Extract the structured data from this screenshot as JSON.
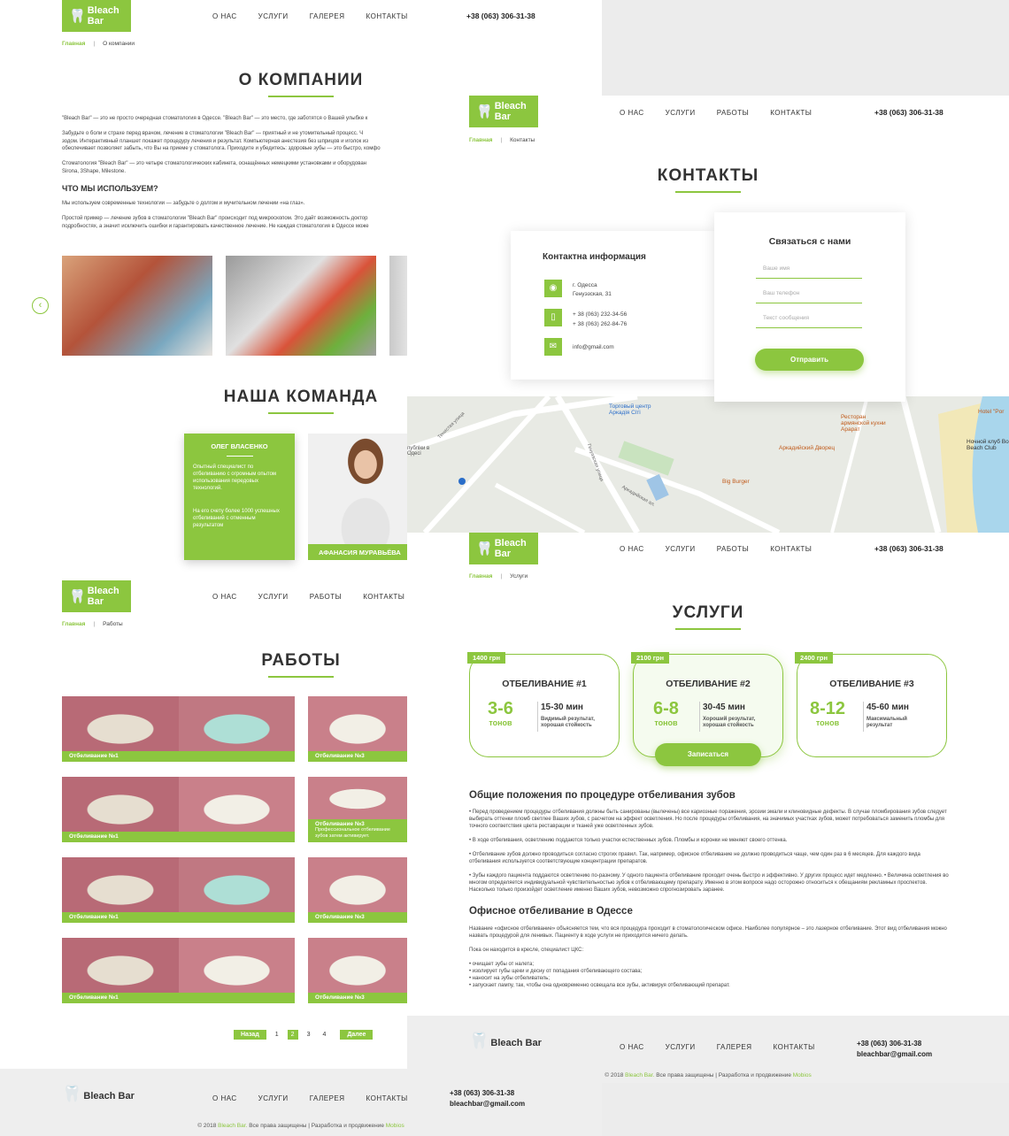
{
  "brand": {
    "name": "Bleach Bar",
    "accent": "#8cc63f"
  },
  "nav_company": [
    "О НАС",
    "УСЛУГИ",
    "ГАЛЕРЕЯ",
    "КОНТАКТЫ"
  ],
  "nav_works": [
    "О НАС",
    "УСЛУГИ",
    "РАБОТЫ",
    "КОНТАКТЫ"
  ],
  "phone": "+38 (063) 306-31-38",
  "email": "bleachbar@gmail.com",
  "company": {
    "crumb_home": "Главная",
    "crumb_current": "О компании",
    "title": "О КОМПАНИИ",
    "p1": "\"Bleach Bar\" — это не просто очередная стоматология в Одессе. \"Bleach Bar\" — это место, где заботятся о Вашей улыбке к",
    "p2a": "Забудьте о боли и страхе перед врачом, лечение в стоматологии \"Bleach Bar\" — приятный и не утомительный процесс. Ч",
    "p2b": "зодом. Интерактивный планшет покажет процедуру лечения и результат. Компьютерная анестезия без шприцов и иголок из",
    "p2c": "обеспечивает позволяет забыть, что Вы на приеме у стоматолога. Приходите и убедитесь: здоровые зубы — это быстро, комфо",
    "p3a": "Стоматология \"Bleach Bar\" — это четыре стоматологических кабинета, оснащённых немецкими установками и оборудован",
    "p3b": "Sirona, 3Shape, Milestone.",
    "subtitle": "ЧТО МЫ ИСПОЛЬЗУЕМ?",
    "p4": "Мы используем современные технологии — забудьте о долгом и мучительном лечении «на глаз».",
    "p5a": "Простой пример — лечение зубов в стоматологии \"Bleach Bar\" происходит под микроскопом. Это дайт возможность доктор",
    "p5b": "подробностях, а значит исключить ошибки и гарантировать качественное лечение. Не каждая стоматология в Одессе може",
    "team_title": "НАША КОМАНДА",
    "member1_name": "ОЛЕГ ВЛАСЕНКО",
    "member1_desc1": "Опытный специалист по отбеливанию с огромным опытом использования передовых технологий.",
    "member1_desc2": "На его счету более 1000 успешных отбеливаний с отменным результатом",
    "member2_name": "АФАНАСИЯ МУРАВЬЁВА"
  },
  "contacts": {
    "crumb_home": "Главная",
    "crumb_current": "Контакты",
    "nav": [
      "О НАС",
      "УСЛУГИ",
      "РАБОТЫ",
      "КОНТАКТЫ"
    ],
    "title": "КОНТАКТЫ",
    "info_title": "Контактна информация",
    "address1": "г. Одесса",
    "address2": "Генуэзская, 31",
    "phone1": "+ 38 (063) 232-34-56",
    "phone2": "+ 38 (063) 262-84-76",
    "mail": "info@gmail.com",
    "form_title": "Связаться с нами",
    "ph_name": "Ваше имя",
    "ph_phone": "Ваш телефон",
    "ph_msg": "Текст сообщения",
    "submit": "Отправить",
    "map_labels": [
      "Торговый центр Аркадія Сіті",
      "Ресторан армянской кухни Арарат",
      "Аркадийский Дворец",
      "Big Burger",
      "Ночной клуб Bono Beach Club",
      "Hotel \"Por",
      "Генуэзская улица",
      "Аркадийская ал.",
      "Тенистая улица",
      "публіки в Одесі"
    ]
  },
  "works": {
    "crumb_home": "Главная",
    "crumb_current": "Работы",
    "title": "РАБОТЫ",
    "labels": [
      "Отбеливание №1",
      "Отбеливание №3",
      "Отбеливание №1",
      "Отбеливание №3",
      "Отбеливание №1",
      "Отбеливание №3",
      "Отбеливание №1",
      "Отбеливание №3"
    ],
    "extra_label": "Профессиональное отбеливание зубов затем активирует.",
    "prev": "Назад",
    "pages": [
      "1",
      "2",
      "3",
      "4"
    ],
    "active_page": "2",
    "next": "Далее"
  },
  "services": {
    "crumb_home": "Главная",
    "crumb_current": "Услуги",
    "title": "УСЛУГИ",
    "cards": [
      {
        "price": "1400 грн",
        "name": "ОТБЕЛИВАНИЕ #1",
        "tones": "3-6",
        "unit": "тонов",
        "time": "15-30 мин",
        "desc": "Видимый результат, хорошая стойкость"
      },
      {
        "price": "2100 грн",
        "name": "ОТБЕЛИВАНИЕ #2",
        "tones": "6-8",
        "unit": "тонов",
        "time": "30-45 мин",
        "desc": "Хороший результат, хорошая стойкость"
      },
      {
        "price": "2400 грн",
        "name": "ОТБЕЛИВАНИЕ #3",
        "tones": "8-12",
        "unit": "тонов",
        "time": "45-60 мин",
        "desc": "Максимальный результат"
      }
    ],
    "signup": "Записаться",
    "h_general": "Общие положения по процедуре отбеливания зубов",
    "g1": "• Перед проведением процедуры отбеливания должны быть санированы (вылечены) все кариозные поражения, эрозии эмали и клиновидные дефекты. В случае пломбирования зубов следует выбирать оттенки пломб светлее Ваших зубов, с расчетом на эффект осветления. Но после процедуры отбеливания, на значимых участках зубов, может потребоваться заменить пломбы для точного соответствия цвета реставрации и тканей уже осветленных зубов.",
    "g2": "• В ходе отбеливания, осветлению поддаются только участки естественных зубов. Пломбы и коронки не меняют своего оттенка.",
    "g3": "• Отбеливание зубов должно проводиться согласно строгих правил. Так, например, офисное отбеливание не должно проводиться чаще, чем один раз в 6 месяцев. Для каждого вида отбеливания используется соответствующие концентрации препаратов.",
    "g4": "• Зубы каждого пациента поддаются осветлению по-разному. У одного пациента отбеливание проходит очень быстро и эффективно. У других процесс идет медленно. • Величина осветления во многом определяется индивидуальной чувствительностью зубов к отбеливающему препарату. Именно в этом вопросе надо осторожно относиться к обещаниям рекламных проспектов. Насколько только произойдет осветление именно Ваших зубов, невозможно спрогнозировать заранее.",
    "h_office": "Офисное отбеливание в Одессе",
    "o1": "Название «офисное отбеливание» объясняется тем, что вся процедура проходит в стоматологическом офисе. Наиболее популярное – это лазерное отбеливание. Этот вид отбеливания можно назвать процедурой для ленивых. Пациенту в ходе услуги не приходится ничего делать.",
    "o2": "Пока он находится в кресле, специалист ЦКС:",
    "list": [
      "• очищает зубы от налета;",
      "• изолирует губы щеки и десну от попадания отбеливающего состава;",
      "• наносит на зубы отбеливатель;",
      "• запускает лампу, так, чтобы она одновременно освещала все зубы, активируя отбеливающий препарат."
    ]
  },
  "footer": {
    "nav1": [
      "О НАС",
      "УСЛУГИ",
      "ГАЛЕРЕЯ",
      "КОНТАКТЫ"
    ],
    "copy_pre": "© 2018",
    "copy_brand": "Bleach Bar.",
    "copy_mid": "Все права защищены | Разработка и продвижение",
    "copy_dev": "Mobios"
  }
}
